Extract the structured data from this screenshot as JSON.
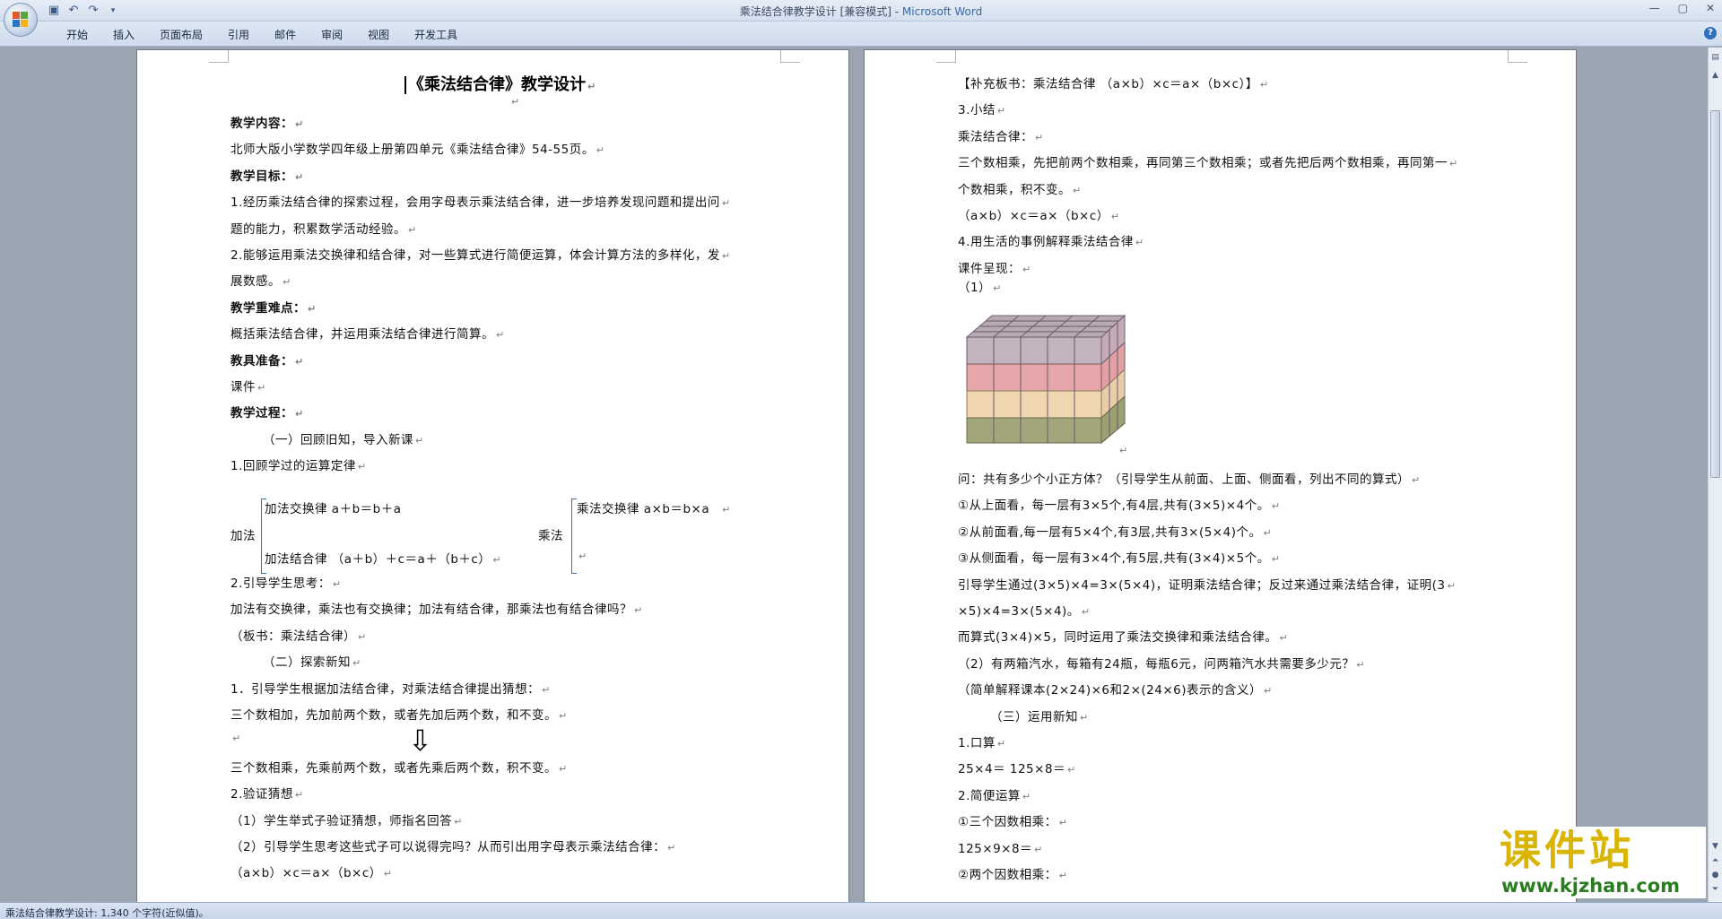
{
  "window": {
    "title": "乘法结合律教学设计 [兼容模式] - ",
    "app_name": "Microsoft Word"
  },
  "ribbon": {
    "tabs": [
      "开始",
      "插入",
      "页面布局",
      "引用",
      "邮件",
      "审阅",
      "视图",
      "开发工具"
    ]
  },
  "left_page": {
    "title": "《乘法结合律》教学设计",
    "lines": [
      {
        "text": "教学内容：",
        "bold": true
      },
      {
        "text": "北师大版小学数学四年级上册第四单元《乘法结合律》54-55页。"
      },
      {
        "text": "教学目标：",
        "bold": true
      },
      {
        "text": "1.经历乘法结合律的探索过程，会用字母表示乘法结合律，进一步培养发现问题和提出问"
      },
      {
        "text": "题的能力，积累数学活动经验。"
      },
      {
        "text": "2.能够运用乘法交换律和结合律，对一些算式进行简便运算，体会计算方法的多样化，发"
      },
      {
        "text": "展数感。"
      },
      {
        "text": "教学重难点：",
        "bold": true
      },
      {
        "text": "概括乘法结合律，并运用乘法结合律进行简算。"
      },
      {
        "text": "教具准备：",
        "bold": true
      },
      {
        "text": "课件"
      },
      {
        "text": "教学过程：",
        "bold": true
      },
      {
        "text": "（一）回顾旧知，导入新课"
      },
      {
        "text": "1.回顾学过的运算定律"
      }
    ],
    "bracket": {
      "add_label": "加法",
      "add_law1": "加法交换律   a＋b＝b＋a",
      "add_law2": "加法结合律   （a＋b）＋c＝a＋（b＋c）",
      "mul_label": "乘法",
      "mul_law1": "乘法交换律   a×b＝b×a"
    },
    "lines2": [
      {
        "text": "2.引导学生思考："
      },
      {
        "text": "加法有交换律，乘法也有交换律；加法有结合律，那乘法也有结合律吗？"
      },
      {
        "text": "（板书：乘法结合律）"
      },
      {
        "text": "（二）探索新知"
      },
      {
        "text": "1．引导学生根据加法结合律，对乘法结合律提出猜想："
      },
      {
        "text": "三个数相加，先加前两个数，或者先加后两个数，和不变。"
      },
      {
        "text": ""
      },
      {
        "text": "三个数相乘，先乘前两个数，或者先乘后两个数，积不变。"
      },
      {
        "text": "2.验证猜想"
      },
      {
        "text": "（1）学生举式子验证猜想，师指名回答"
      },
      {
        "text": "（2）引导学生思考这些式子可以说得完吗？从而引出用字母表示乘法结合律："
      },
      {
        "text": "（a×b）×c＝a×（b×c）"
      }
    ],
    "arrow": "⇩"
  },
  "right_page": {
    "lines": [
      {
        "text": "【补充板书：乘法结合律   （a×b）×c＝a×（b×c）】"
      },
      {
        "text": "3.小结"
      },
      {
        "text": "乘法结合律："
      },
      {
        "text": "三个数相乘，先把前两个数相乘，再同第三个数相乘；或者先把后两个数相乘，再同第一"
      },
      {
        "text": "个数相乘，积不变。"
      },
      {
        "text": "（a×b）×c＝a×（b×c）"
      },
      {
        "text": "4.用生活的事例解释乘法结合律"
      },
      {
        "text": "课件呈现："
      },
      {
        "text": "（1）"
      }
    ],
    "lines2": [
      {
        "text": "问：共有多少个小正方体？（引导学生从前面、上面、侧面看，列出不同的算式）"
      },
      {
        "text": "①从上面看，每一层有3×5个,有4层,共有(3×5)×4个。"
      },
      {
        "text": "②从前面看,每一层有5×4个,有3层,共有3×(5×4)个。"
      },
      {
        "text": "③从侧面看，每一层有3×4个,有5层,共有(3×4)×5个。"
      },
      {
        "text": "引导学生通过(3×5)×4=3×(5×4)，证明乘法结合律；反过来通过乘法结合律，证明(3"
      },
      {
        "text": "×5)×4=3×(5×4)。"
      },
      {
        "text": "而算式(3×4)×5，同时运用了乘法交换律和乘法结合律。"
      },
      {
        "text": "（2）有两箱汽水，每箱有24瓶，每瓶6元，问两箱汽水共需要多少元？"
      },
      {
        "text": "（简单解释课本(2×24)×6和2×(24×6)表示的含义）"
      },
      {
        "text": "（三）运用新知"
      },
      {
        "text": "1.口算"
      },
      {
        "text": "25×4＝                 125×8＝"
      },
      {
        "text": "2.简便运算"
      },
      {
        "text": "①三个因数相乘："
      },
      {
        "text": "125×9×8＝"
      },
      {
        "text": "②两个因数相乘："
      }
    ]
  },
  "status": {
    "text": "乘法结合律教学设计: 1,340 个字符(近似值)。"
  },
  "watermark": {
    "big": "课件站",
    "url": "www.kjzhan.com"
  },
  "icons": {
    "paragraph_mark": "↵"
  }
}
